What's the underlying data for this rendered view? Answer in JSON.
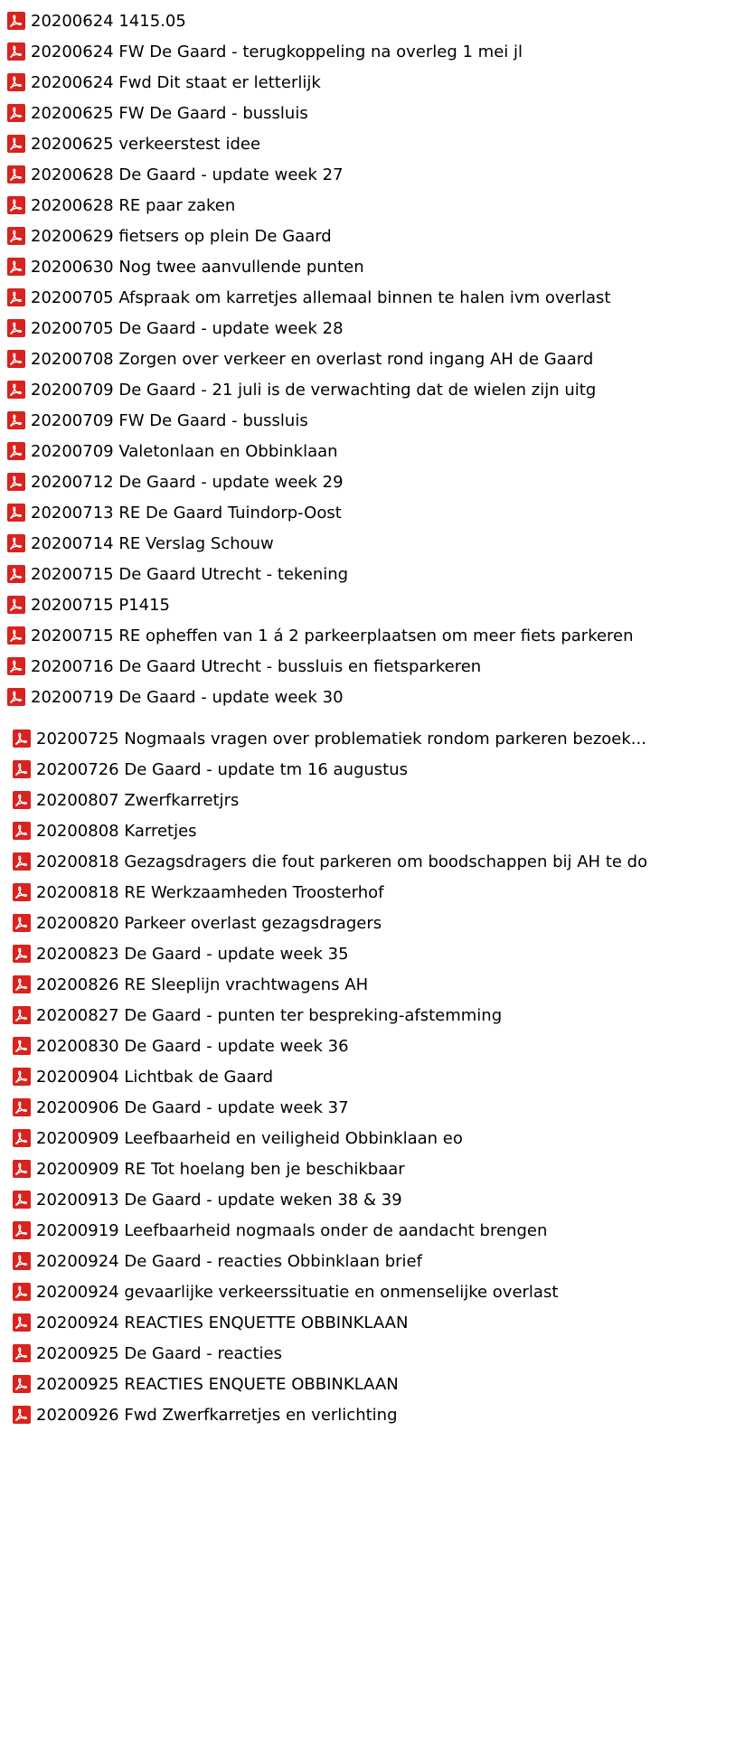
{
  "file_list": {
    "icon": "acrobat-pdf-icon",
    "icon_color": "#d8231f",
    "items_group_1": [
      "20200624 1415.05",
      "20200624 FW De Gaard - terugkoppeling na overleg 1 mei jl",
      "20200624 Fwd Dit staat er letterlijk",
      "20200625 FW De Gaard - bussluis",
      "20200625 verkeerstest idee",
      "20200628 De Gaard - update week 27",
      "20200628 RE paar zaken",
      "20200629 fietsers op plein De Gaard",
      "20200630 Nog twee aanvullende punten",
      "20200705 Afspraak om karretjes allemaal binnen te halen ivm overlast",
      "20200705 De Gaard - update week 28",
      "20200708 Zorgen over verkeer en overlast rond ingang AH de Gaard",
      "20200709 De Gaard - 21 juli is de verwachting dat de wielen zijn uitg",
      "20200709 FW De Gaard - bussluis",
      "20200709 Valetonlaan en Obbinklaan",
      "20200712 De Gaard - update week 29",
      "20200713 RE De Gaard Tuindorp-Oost",
      "20200714 RE Verslag Schouw",
      "20200715 De Gaard Utrecht - tekening",
      "20200715 P1415",
      "20200715 RE opheffen van 1 á 2 parkeerplaatsen om meer fiets parkeren",
      "20200716 De Gaard Utrecht - bussluis en fietsparkeren",
      "20200719 De Gaard - update week 30"
    ],
    "items_group_2": [
      "20200725 Nogmaals vragen over problematiek rondom parkeren bezoek...",
      "20200726 De Gaard - update tm 16 augustus",
      "20200807 Zwerfkarretjrs",
      "20200808 Karretjes",
      "20200818 Gezagsdragers die fout parkeren om boodschappen bij AH te do",
      "20200818 RE Werkzaamheden Troosterhof",
      "20200820 Parkeer overlast gezagsdragers",
      "20200823 De Gaard - update week 35",
      "20200826 RE Sleeplijn vrachtwagens AH",
      "20200827 De Gaard - punten ter bespreking-afstemming",
      "20200830 De Gaard - update week 36",
      "20200904 Lichtbak de Gaard",
      "20200906 De Gaard - update week 37",
      "20200909 Leefbaarheid en veiligheid Obbinklaan eo",
      "20200909 RE Tot hoelang ben je beschikbaar",
      "20200913 De Gaard - update weken 38 & 39",
      "20200919 Leefbaarheid nogmaals onder de aandacht brengen",
      "20200924 De Gaard - reacties Obbinklaan brief",
      "20200924 gevaarlijke verkeerssituatie en onmenselijke overlast",
      "20200924 REACTIES ENQUETTE OBBINKLAAN",
      "20200925 De Gaard - reacties",
      "20200925 REACTIES ENQUETE OBBINKLAAN",
      "20200926 Fwd Zwerfkarretjes en verlichting"
    ]
  }
}
